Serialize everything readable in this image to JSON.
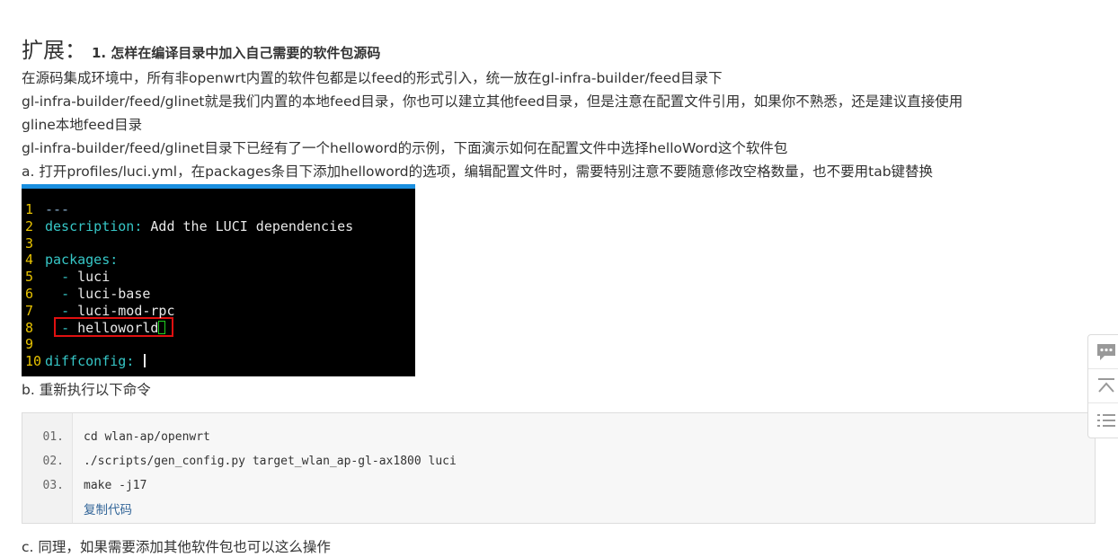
{
  "heading": {
    "big": "扩展：",
    "small": "1. 怎样在编译目录中加入自己需要的软件包源码"
  },
  "paragraphs": {
    "p1": "在源码集成环境中，所有非openwrt内置的软件包都是以feed的形式引入，统一放在gl-infra-builder/feed目录下",
    "p2_line1": "gl-infra-builder/feed/glinet就是我们内置的本地feed目录，你也可以建立其他feed目录，但是注意在配置文件引用，如果你不熟悉，还是建议直接使用",
    "p2_line2": "gline本地feed目录",
    "p3": "gl-infra-builder/feed/glinet目录下已经有了一个helloword的示例，下面演示如何在配置文件中选择helloWord这个软件包",
    "step_a": "a. 打开profiles/luci.yml，在packages条目下添加helloword的选项，编辑配置文件时，需要特别注意不要随意修改空格数量，也不要用tab键替换",
    "step_b": "b. 重新执行以下命令",
    "step_c": "c. 同理，如果需要添加其他软件包也可以这么操作"
  },
  "terminal": {
    "lines": [
      {
        "n": "1",
        "t": "---"
      },
      {
        "n": "2",
        "key": "description",
        "sep": ":",
        "val": " Add the LUCI dependencies"
      },
      {
        "n": "3",
        "t": ""
      },
      {
        "n": "4",
        "key": "packages",
        "sep": ":",
        "val": ""
      },
      {
        "n": "5",
        "item": "luci"
      },
      {
        "n": "6",
        "item": "luci-base"
      },
      {
        "n": "7",
        "item": "luci-mod-rpc"
      },
      {
        "n": "8",
        "item": "helloworld"
      },
      {
        "n": "9",
        "t": ""
      },
      {
        "n": "10",
        "key": "diffconfig",
        "sep": ":",
        "val": " "
      }
    ],
    "dash": "- "
  },
  "code": {
    "lines": [
      {
        "num": "01.",
        "text": "cd wlan-ap/openwrt"
      },
      {
        "num": "02.",
        "text": "./scripts/gen_config.py target_wlan_ap-gl-ax1800 luci"
      },
      {
        "num": "03.",
        "text": "make -j17"
      }
    ],
    "copy_label": "复制代码"
  },
  "side_tools": {
    "icons": [
      "comment-icon",
      "back-to-top-icon",
      "list-icon"
    ]
  },
  "colors": {
    "text": "#333333",
    "link": "#336699",
    "terminal_bg": "#000000",
    "terminal_key": "#36c6c6",
    "terminal_linenum": "#e8c300",
    "highlight_box": "#e01010",
    "terminal_topbar": "#1a8fe0"
  }
}
